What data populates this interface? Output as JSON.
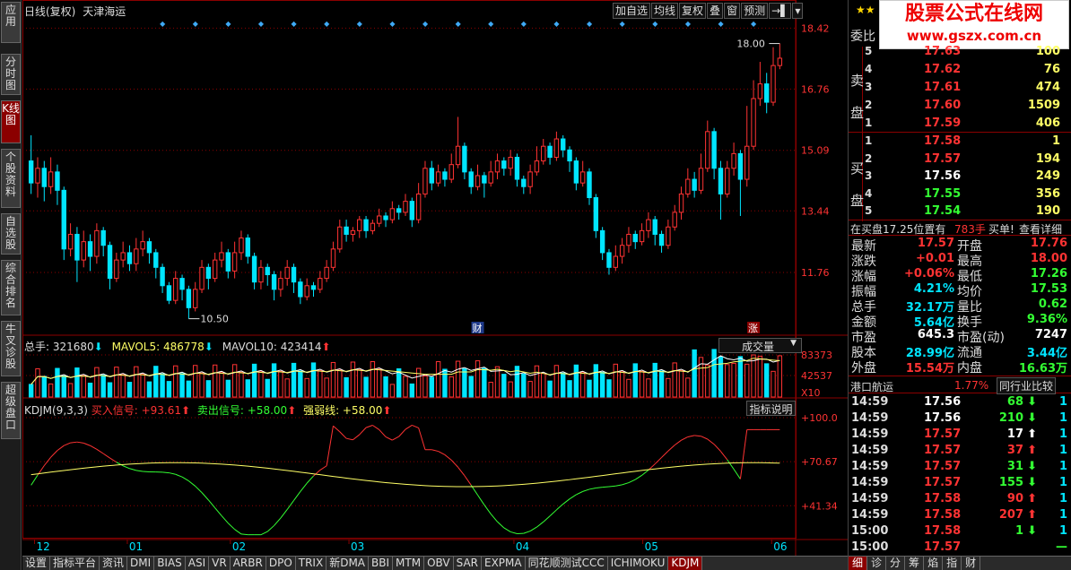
{
  "left_tabs": [
    "应用",
    "分时图",
    "K线图",
    "个股资料",
    "自选股",
    "综合排名",
    "牛叉诊股",
    "超级盘口"
  ],
  "header": {
    "period": "日线(复权)",
    "stock": "天津海运"
  },
  "toolbar": [
    "加自选",
    "均线",
    "复权",
    "叠",
    "窗",
    "预测"
  ],
  "price_axis": [
    "18.42",
    "16.76",
    "15.09",
    "13.44",
    "11.76"
  ],
  "price_marks": {
    "high": "18.00",
    "low": "10.50",
    "event1": "财",
    "event2": "涨"
  },
  "volume": {
    "total_label": "总手: 321680",
    "mavol5": "MAVOL5: 486778",
    "mavol10": "MAVOL10: 423414",
    "selector": "成交量",
    "axis": [
      "83373",
      "42537",
      "X10"
    ]
  },
  "kdj": {
    "title": "KDJM(9,3,3)",
    "buy": "买入信号: +93.61",
    "sell": "卖出信号: +58.00",
    "strong": "强弱线: +58.00",
    "button": "指标说明",
    "axis": [
      "+100.0",
      "+70.67",
      "+41.34"
    ]
  },
  "date_axis": [
    "12",
    "01",
    "02",
    "03",
    "04",
    "05",
    "06"
  ],
  "bottom_tabs": [
    "设置",
    "指标平台",
    "资讯",
    "DMI",
    "BIAS",
    "ASI",
    "VR",
    "ARBR",
    "DPO",
    "TRIX",
    "新DMA",
    "BBI",
    "MTM",
    "OBV",
    "SAR",
    "EXPMA",
    "同花顺测试CCC",
    "ICHIMOKU",
    "KDJM"
  ],
  "right_bottom_tabs": [
    "细",
    "诊",
    "分",
    "筹",
    "焰",
    "指",
    "财"
  ],
  "banner": {
    "title": "股票公式在线网",
    "url": "www.gszx.com.cn",
    "weibi": "委比"
  },
  "orderbook": {
    "sell_label": [
      "卖",
      "盘"
    ],
    "buy_label": [
      "买",
      "盘"
    ],
    "sell": [
      {
        "level": "5",
        "price": "17.63",
        "vol": "100"
      },
      {
        "level": "4",
        "price": "17.62",
        "vol": "76"
      },
      {
        "level": "3",
        "price": "17.61",
        "vol": "474"
      },
      {
        "level": "2",
        "price": "17.60",
        "vol": "1509"
      },
      {
        "level": "1",
        "price": "17.59",
        "vol": "406"
      }
    ],
    "buy": [
      {
        "level": "1",
        "price": "17.58",
        "vol": "1"
      },
      {
        "level": "2",
        "price": "17.57",
        "vol": "194"
      },
      {
        "level": "3",
        "price": "17.56",
        "vol": "249"
      },
      {
        "level": "4",
        "price": "17.55",
        "vol": "356"
      },
      {
        "level": "5",
        "price": "17.54",
        "vol": "190"
      }
    ]
  },
  "notice": {
    "text": "在买盘17.25位置有",
    "vol": "783手",
    "action": "买单!",
    "link": "查看详细"
  },
  "stats": [
    {
      "l1": "最新",
      "v1": "17.57",
      "l2": "开盘",
      "v2": "17.76"
    },
    {
      "l1": "涨跌",
      "v1": "+0.01",
      "l2": "最高",
      "v2": "18.00"
    },
    {
      "l1": "涨幅",
      "v1": "+0.06%",
      "l2": "最低",
      "v2": "17.26"
    },
    {
      "l1": "振幅",
      "v1": "4.21%",
      "l2": "均价",
      "v2": "17.53"
    },
    {
      "l1": "总手",
      "v1": "32.17万",
      "l2": "量比",
      "v2": "0.62"
    },
    {
      "l1": "金额",
      "v1": "5.64亿",
      "l2": "换手",
      "v2": "9.36%"
    },
    {
      "l1": "市盈",
      "v1": "645.3",
      "l2": "市盈(动)",
      "v2": "7247"
    },
    {
      "l1": "股本",
      "v1": "28.99亿",
      "l2": "流通",
      "v2": "3.44亿"
    },
    {
      "l1": "外盘",
      "v1": "15.54万",
      "l2": "内盘",
      "v2": "16.63万"
    }
  ],
  "sector": {
    "name": "港口航运",
    "change": "1.77%",
    "button": "同行业比较"
  },
  "ticks": [
    {
      "time": "14:59",
      "price": "17.56",
      "vol": "68",
      "dir": "down",
      "n": "1"
    },
    {
      "time": "14:59",
      "price": "17.56",
      "vol": "210",
      "dir": "down",
      "n": "1"
    },
    {
      "time": "14:59",
      "price": "17.57",
      "vol": "17",
      "dir": "up_w",
      "n": "1"
    },
    {
      "time": "14:59",
      "price": "17.57",
      "vol": "37",
      "dir": "up",
      "n": "1"
    },
    {
      "time": "14:59",
      "price": "17.57",
      "vol": "31",
      "dir": "down",
      "n": "1"
    },
    {
      "time": "14:59",
      "price": "17.57",
      "vol": "155",
      "dir": "down",
      "n": "1"
    },
    {
      "time": "14:59",
      "price": "17.58",
      "vol": "90",
      "dir": "up",
      "n": "1"
    },
    {
      "time": "14:59",
      "price": "17.58",
      "vol": "207",
      "dir": "up",
      "n": "1"
    },
    {
      "time": "15:00",
      "price": "17.58",
      "vol": "1",
      "dir": "down",
      "n": "1"
    },
    {
      "time": "15:00",
      "price": "17.57",
      "vol": "",
      "dir": "none",
      "n": "—"
    }
  ],
  "colors": {
    "up": "#ff3333",
    "down": "#00e5ff",
    "green": "#33ff33",
    "yellow": "#ffff66",
    "white": "#ffffff",
    "grid": "#8b0000"
  },
  "chart_data": {
    "type": "candlestick",
    "ylim": [
      10.5,
      18.42
    ],
    "price_ticks": [
      18.42,
      16.76,
      15.09,
      13.44,
      11.76
    ],
    "candles": [
      [
        14.8,
        14.2,
        15.5,
        13.9
      ],
      [
        14.2,
        14.6,
        14.9,
        13.8
      ],
      [
        14.6,
        14.1,
        14.8,
        13.7
      ],
      [
        14.1,
        14.5,
        14.9,
        13.9
      ],
      [
        14.5,
        14.0,
        14.7,
        13.6
      ],
      [
        14.0,
        12.4,
        14.1,
        12.1
      ],
      [
        12.4,
        12.8,
        13.1,
        12.2
      ],
      [
        12.8,
        12.1,
        13.0,
        11.5
      ],
      [
        12.1,
        12.6,
        12.9,
        11.9
      ],
      [
        12.6,
        12.2,
        12.8,
        11.8
      ],
      [
        12.2,
        12.9,
        13.1,
        12.0
      ],
      [
        12.9,
        12.5,
        13.0,
        12.2
      ],
      [
        12.5,
        11.6,
        12.6,
        11.3
      ],
      [
        11.6,
        12.1,
        12.3,
        11.5
      ],
      [
        12.1,
        12.3,
        12.6,
        11.9
      ],
      [
        12.3,
        12.0,
        12.5,
        11.8
      ],
      [
        12.0,
        12.4,
        12.7,
        11.8
      ],
      [
        12.4,
        12.6,
        12.9,
        12.2
      ],
      [
        12.6,
        12.3,
        12.7,
        12.0
      ],
      [
        12.3,
        11.9,
        12.4,
        11.6
      ],
      [
        11.9,
        11.4,
        12.0,
        11.2
      ],
      [
        11.4,
        11.0,
        11.5,
        10.9
      ],
      [
        11.0,
        11.6,
        11.8,
        10.9
      ],
      [
        11.6,
        11.3,
        11.7,
        11.0
      ],
      [
        11.3,
        10.8,
        11.4,
        10.5
      ],
      [
        10.8,
        11.3,
        11.5,
        10.7
      ],
      [
        11.3,
        11.9,
        12.1,
        11.2
      ],
      [
        11.9,
        11.6,
        12.0,
        11.3
      ],
      [
        11.6,
        12.1,
        12.3,
        11.5
      ],
      [
        12.1,
        12.3,
        12.6,
        11.9
      ],
      [
        12.3,
        11.8,
        12.4,
        11.6
      ],
      [
        11.8,
        12.3,
        12.6,
        11.6
      ],
      [
        12.3,
        12.7,
        12.9,
        12.1
      ],
      [
        12.7,
        12.2,
        12.8,
        12.0
      ],
      [
        12.2,
        11.5,
        12.3,
        11.3
      ],
      [
        11.5,
        11.9,
        12.1,
        11.3
      ],
      [
        11.9,
        11.7,
        12.0,
        11.4
      ],
      [
        11.7,
        11.3,
        11.8,
        11.0
      ],
      [
        11.3,
        11.6,
        11.8,
        11.1
      ],
      [
        11.6,
        11.9,
        12.1,
        11.4
      ],
      [
        11.9,
        11.5,
        12.0,
        11.2
      ],
      [
        11.5,
        11.1,
        11.6,
        10.9
      ],
      [
        11.1,
        11.4,
        11.6,
        11.0
      ],
      [
        11.4,
        11.3,
        11.5,
        11.1
      ],
      [
        11.3,
        11.6,
        11.8,
        11.2
      ],
      [
        11.6,
        11.9,
        12.1,
        11.5
      ],
      [
        11.9,
        12.4,
        12.6,
        11.8
      ],
      [
        12.4,
        13.0,
        13.2,
        12.3
      ],
      [
        13.0,
        12.8,
        13.2,
        12.6
      ],
      [
        12.8,
        12.9,
        13.0,
        12.6
      ],
      [
        12.9,
        13.2,
        13.3,
        12.7
      ],
      [
        13.2,
        12.9,
        13.3,
        12.7
      ],
      [
        12.9,
        13.1,
        13.2,
        12.8
      ],
      [
        13.1,
        13.3,
        13.5,
        13.0
      ],
      [
        13.3,
        13.2,
        13.4,
        13.0
      ],
      [
        13.2,
        13.5,
        13.7,
        13.1
      ],
      [
        13.5,
        13.4,
        13.6,
        13.2
      ],
      [
        13.4,
        13.7,
        13.9,
        13.3
      ],
      [
        13.7,
        13.2,
        13.8,
        13.0
      ],
      [
        13.2,
        13.9,
        14.2,
        13.1
      ],
      [
        13.9,
        14.6,
        14.8,
        13.8
      ],
      [
        14.6,
        14.2,
        14.8,
        14.0
      ],
      [
        14.2,
        14.5,
        14.7,
        14.1
      ],
      [
        14.5,
        14.3,
        14.6,
        14.1
      ],
      [
        14.3,
        14.7,
        15.0,
        14.2
      ],
      [
        14.7,
        15.2,
        16.0,
        14.6
      ],
      [
        15.2,
        14.5,
        15.3,
        14.3
      ],
      [
        14.5,
        14.1,
        14.6,
        13.9
      ],
      [
        14.1,
        14.4,
        14.7,
        14.0
      ],
      [
        14.4,
        14.2,
        14.5,
        13.8
      ],
      [
        14.2,
        14.5,
        14.8,
        14.1
      ],
      [
        14.5,
        14.8,
        15.0,
        14.3
      ],
      [
        14.8,
        14.6,
        14.9,
        14.4
      ],
      [
        14.6,
        14.9,
        15.1,
        14.4
      ],
      [
        14.9,
        14.3,
        15.0,
        14.1
      ],
      [
        14.3,
        14.1,
        14.4,
        13.9
      ],
      [
        14.1,
        14.5,
        14.7,
        13.9
      ],
      [
        14.5,
        14.8,
        15.2,
        14.4
      ],
      [
        14.8,
        15.2,
        15.4,
        14.7
      ],
      [
        15.2,
        14.9,
        15.3,
        14.7
      ],
      [
        14.9,
        15.4,
        15.6,
        14.8
      ],
      [
        15.4,
        15.1,
        15.5,
        14.9
      ],
      [
        15.1,
        14.8,
        15.2,
        14.5
      ],
      [
        14.8,
        14.2,
        14.9,
        14.0
      ],
      [
        14.2,
        14.5,
        14.8,
        14.1
      ],
      [
        14.5,
        13.8,
        14.6,
        13.6
      ],
      [
        13.8,
        12.9,
        13.9,
        12.7
      ],
      [
        12.9,
        12.3,
        13.0,
        12.1
      ],
      [
        12.3,
        11.9,
        12.4,
        11.7
      ],
      [
        11.9,
        12.2,
        12.5,
        11.8
      ],
      [
        12.2,
        12.5,
        12.7,
        12.0
      ],
      [
        12.5,
        12.8,
        13.0,
        12.3
      ],
      [
        12.8,
        12.6,
        12.9,
        12.4
      ],
      [
        12.6,
        12.9,
        13.1,
        12.5
      ],
      [
        12.9,
        13.2,
        13.4,
        12.7
      ],
      [
        13.2,
        12.8,
        13.3,
        12.5
      ],
      [
        12.8,
        12.5,
        12.9,
        12.3
      ],
      [
        12.5,
        13.0,
        13.2,
        12.4
      ],
      [
        13.0,
        13.4,
        13.6,
        12.9
      ],
      [
        13.4,
        13.9,
        14.1,
        13.2
      ],
      [
        13.9,
        14.3,
        14.6,
        13.8
      ],
      [
        14.3,
        14.0,
        14.5,
        13.8
      ],
      [
        14.0,
        14.6,
        15.0,
        13.9
      ],
      [
        14.6,
        15.6,
        15.9,
        14.5
      ],
      [
        15.6,
        14.6,
        15.7,
        14.3
      ],
      [
        14.6,
        13.9,
        14.8,
        13.2
      ],
      [
        13.9,
        14.6,
        14.8,
        13.8
      ],
      [
        14.6,
        15.0,
        15.3,
        14.4
      ],
      [
        15.0,
        14.3,
        15.1,
        13.3
      ],
      [
        14.3,
        15.2,
        16.3,
        14.1
      ],
      [
        15.2,
        16.5,
        17.0,
        15.1
      ],
      [
        16.5,
        16.9,
        17.5,
        16.3
      ],
      [
        16.9,
        16.4,
        17.2,
        16.1
      ],
      [
        16.4,
        17.4,
        17.9,
        16.3
      ],
      [
        17.4,
        17.6,
        18.0,
        17.3
      ]
    ],
    "vol_ticks": [
      83373,
      42537
    ],
    "kdj_ticks": [
      100.0,
      70.67,
      41.34
    ]
  }
}
